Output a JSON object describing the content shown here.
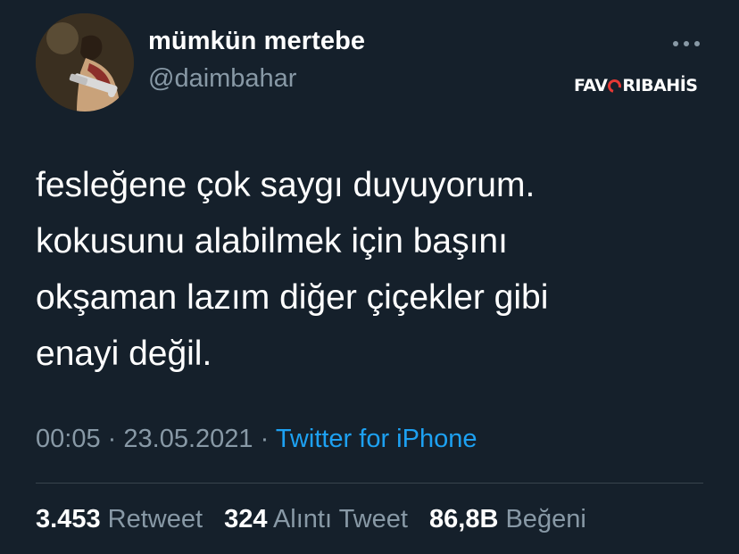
{
  "author": {
    "display_name": "mümkün mertebe",
    "handle": "@daimbahar"
  },
  "sponsor": {
    "part1": "FAV",
    "part2": "RIBAHİS"
  },
  "tweet": {
    "lines": [
      "fesleğene çok saygı duyuyorum.",
      "kokusunu alabilmek için başını",
      "okşaman lazım diğer çiçekler gibi",
      "enayi değil."
    ],
    "time": "00:05",
    "separator": "·",
    "date": "23.05.2021",
    "source": "Twitter for iPhone"
  },
  "stats": {
    "retweets": {
      "count": "3.453",
      "label": "Retweet"
    },
    "quotes": {
      "count": "324",
      "label": "Alıntı Tweet"
    },
    "likes": {
      "count": "86,8B",
      "label": "Beğeni"
    }
  },
  "icons": {
    "more": "more-horizontal-icon"
  },
  "colors": {
    "background": "#15202b",
    "primary_text": "#ffffff",
    "secondary_text": "#8899a6",
    "link": "#1da1f2",
    "divider": "#38444d",
    "sponsor_accent": "#e53935"
  }
}
